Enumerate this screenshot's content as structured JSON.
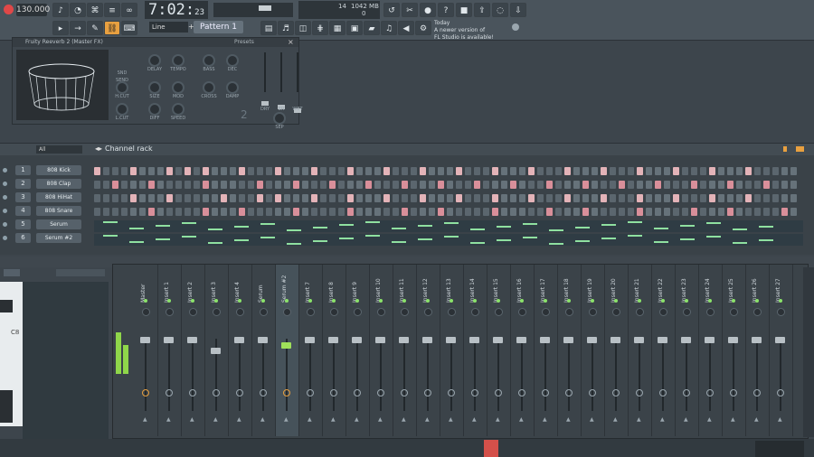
{
  "toolbar": {
    "tempo": "130.000",
    "time_main": "7:02",
    "time_sub": "23",
    "cpu_voices": "14",
    "cpu_memory": "1042 MB",
    "cpu_zero": "0",
    "line_mode": "Line",
    "pattern": "Pattern 1",
    "hint_title": "Today",
    "hint_text_1": "A newer version of",
    "hint_text_2": "FL Studio is available!"
  },
  "plugin": {
    "title": "Fruity Reeverb 2 (Master FX)",
    "presets_label": "Presets",
    "labels": [
      "SND",
      "SEND",
      "DELAY",
      "TEMPO",
      "BASS",
      "DEC",
      "H.CUT",
      "SIZE",
      "MOD",
      "CROSS",
      "DAMP",
      "DRY",
      "ER",
      "WET",
      "L.CUT",
      "DIFF",
      "SPEED",
      "SEP"
    ],
    "number": "2"
  },
  "rack": {
    "title": "Channel rack",
    "filter": "All",
    "channels": [
      {
        "num": "1",
        "name": "808 Kick"
      },
      {
        "num": "2",
        "name": "808 Clap"
      },
      {
        "num": "3",
        "name": "808 HiHat"
      },
      {
        "num": "4",
        "name": "808 Snare"
      },
      {
        "num": "5",
        "name": "Serum"
      },
      {
        "num": "6",
        "name": "Serum #2"
      }
    ]
  },
  "piano": {
    "note_label": "C8"
  },
  "mixer": {
    "strips": [
      "Master",
      "Insert 1",
      "Insert 2",
      "Insert 3",
      "Insert 4",
      "Serum",
      "Serum #2",
      "Insert 7",
      "Insert 8",
      "Insert 9",
      "Insert 10",
      "Insert 11",
      "Insert 12",
      "Insert 13",
      "Insert 14",
      "Insert 15",
      "Insert 16",
      "Insert 17",
      "Insert 18",
      "Insert 19",
      "Insert 20",
      "Insert 21",
      "Insert 22",
      "Insert 23",
      "Insert 24",
      "Insert 25",
      "Insert 26",
      "Insert 27"
    ]
  },
  "colors": {
    "accent": "#e8a040",
    "led": "#8be36a",
    "step_on": "#d98f9a",
    "step_off": "#5b666e"
  }
}
